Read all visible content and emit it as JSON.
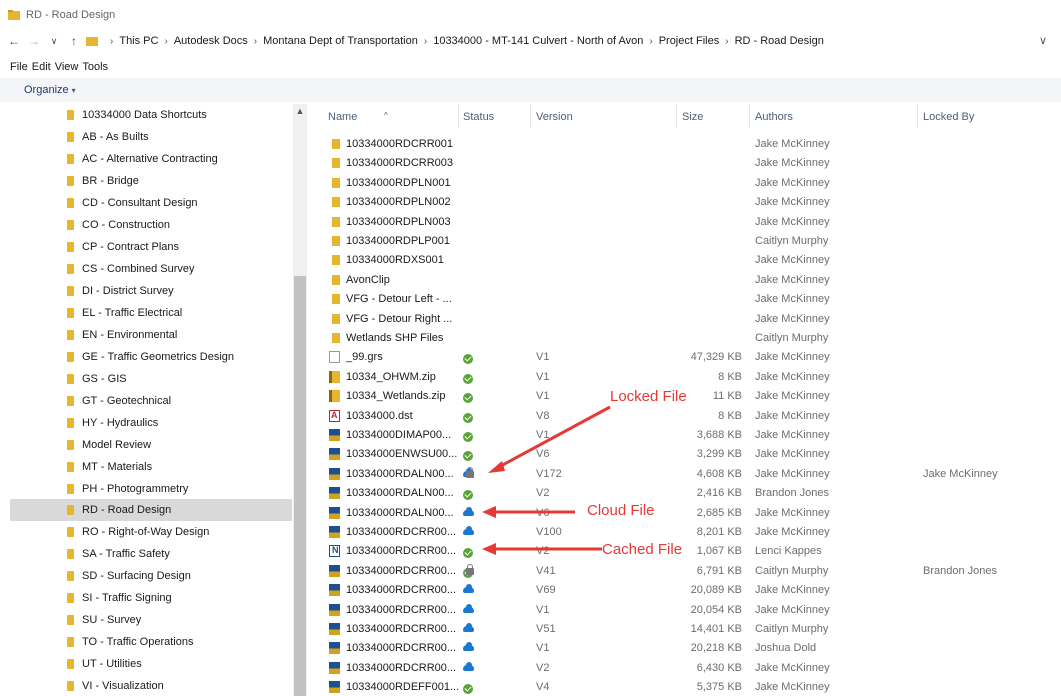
{
  "window": {
    "title": "RD - Road Design"
  },
  "address": {
    "back_glyph": "←",
    "forward_glyph": "→",
    "dropdown_glyph": "∨",
    "up_glyph": "↑",
    "separator": "›",
    "crumbs": [
      "This PC",
      "Autodesk Docs",
      "Montana Dept of Transportation",
      "10334000 - MT-141 Culvert - North of Avon",
      "Project Files",
      "RD - Road Design"
    ],
    "history_glyph": "∨"
  },
  "menu": {
    "items": [
      "File",
      "Edit",
      "View",
      "Tools"
    ]
  },
  "commandbar": {
    "organize": "Organize",
    "caret": "▾"
  },
  "nav": {
    "items": [
      "10334000 Data Shortcuts",
      "AB - As Builts",
      "AC - Alternative Contracting",
      "BR - Bridge",
      "CD - Consultant Design",
      "CO - Construction",
      "CP - Contract Plans",
      "CS - Combined Survey",
      "DI - District Survey",
      "EL - Traffic Electrical",
      "EN - Environmental",
      "GE - Traffic Geometrics Design",
      "GS - GIS",
      "GT - Geotechnical",
      "HY - Hydraulics",
      "Model Review",
      "MT - Materials",
      "PH - Photogrammetry",
      "RD - Road Design",
      "RO - Right-of-Way Design",
      "SA - Traffic Safety",
      "SD - Surfacing Design",
      "SI - Traffic Signing",
      "SU - Survey",
      "TO - Traffic Operations",
      "UT - Utilities",
      "VI - Visualization"
    ],
    "selected_index": 18,
    "scroll_up_glyph": "▲"
  },
  "columns": {
    "name": "Name",
    "status": "Status",
    "version": "Version",
    "size": "Size",
    "authors": "Authors",
    "locked_by": "Locked By",
    "sort_glyph": "^"
  },
  "files": [
    {
      "name": "10334000RDCRR001",
      "icon": "folder",
      "status": "",
      "version": "",
      "size": "",
      "author": "Jake McKinney",
      "locked_by": ""
    },
    {
      "name": "10334000RDCRR003",
      "icon": "folder",
      "status": "",
      "version": "",
      "size": "",
      "author": "Jake McKinney",
      "locked_by": ""
    },
    {
      "name": "10334000RDPLN001",
      "icon": "folder",
      "status": "",
      "version": "",
      "size": "",
      "author": "Jake McKinney",
      "locked_by": ""
    },
    {
      "name": "10334000RDPLN002",
      "icon": "folder",
      "status": "",
      "version": "",
      "size": "",
      "author": "Jake McKinney",
      "locked_by": ""
    },
    {
      "name": "10334000RDPLN003",
      "icon": "folder",
      "status": "",
      "version": "",
      "size": "",
      "author": "Jake McKinney",
      "locked_by": ""
    },
    {
      "name": "10334000RDPLP001",
      "icon": "folder",
      "status": "",
      "version": "",
      "size": "",
      "author": "Caitlyn Murphy",
      "locked_by": ""
    },
    {
      "name": "10334000RDXS001",
      "icon": "folder",
      "status": "",
      "version": "",
      "size": "",
      "author": "Jake McKinney",
      "locked_by": ""
    },
    {
      "name": "AvonClip",
      "icon": "folder",
      "status": "",
      "version": "",
      "size": "",
      "author": "Jake McKinney",
      "locked_by": ""
    },
    {
      "name": "VFG - Detour Left - ...",
      "icon": "folder",
      "status": "",
      "version": "",
      "size": "",
      "author": "Jake McKinney",
      "locked_by": ""
    },
    {
      "name": "VFG - Detour Right ...",
      "icon": "folder",
      "status": "",
      "version": "",
      "size": "",
      "author": "Jake McKinney",
      "locked_by": ""
    },
    {
      "name": "Wetlands SHP Files",
      "icon": "folder",
      "status": "",
      "version": "",
      "size": "",
      "author": "Caitlyn Murphy",
      "locked_by": ""
    },
    {
      "name": "_99.grs",
      "icon": "doc",
      "status": "cached",
      "version": "V1",
      "size": "47,329 KB",
      "author": "Jake McKinney",
      "locked_by": ""
    },
    {
      "name": "10334_OHWM.zip",
      "icon": "zip",
      "status": "cached",
      "version": "V1",
      "size": "8 KB",
      "author": "Jake McKinney",
      "locked_by": ""
    },
    {
      "name": "10334_Wetlands.zip",
      "icon": "zip",
      "status": "cached",
      "version": "V1",
      "size": "11 KB",
      "author": "Jake McKinney",
      "locked_by": ""
    },
    {
      "name": "10334000.dst",
      "icon": "dst",
      "status": "cached",
      "version": "V8",
      "size": "8 KB",
      "author": "Jake McKinney",
      "locked_by": ""
    },
    {
      "name": "10334000DIMAP00...",
      "icon": "dgn",
      "status": "cached",
      "version": "V1",
      "size": "3,688 KB",
      "author": "Jake McKinney",
      "locked_by": ""
    },
    {
      "name": "10334000ENWSU00...",
      "icon": "dgn",
      "status": "cached",
      "version": "V6",
      "size": "3,299 KB",
      "author": "Jake McKinney",
      "locked_by": ""
    },
    {
      "name": "10334000RDALN00...",
      "icon": "dgn",
      "status": "cloud-locked",
      "version": "V172",
      "size": "4,608 KB",
      "author": "Jake McKinney",
      "locked_by": "Jake McKinney"
    },
    {
      "name": "10334000RDALN00...",
      "icon": "dgn",
      "status": "cached",
      "version": "V2",
      "size": "2,416 KB",
      "author": "Brandon Jones",
      "locked_by": ""
    },
    {
      "name": "10334000RDALN00...",
      "icon": "dgn",
      "status": "cloud",
      "version": "V6",
      "size": "2,685 KB",
      "author": "Jake McKinney",
      "locked_by": ""
    },
    {
      "name": "10334000RDCRR00...",
      "icon": "dgn",
      "status": "cloud",
      "version": "V100",
      "size": "8,201 KB",
      "author": "Jake McKinney",
      "locked_by": ""
    },
    {
      "name": "10334000RDCRR00...",
      "icon": "dgnn",
      "status": "cached",
      "version": "V2",
      "size": "1,067 KB",
      "author": "Lenci Kappes",
      "locked_by": ""
    },
    {
      "name": "10334000RDCRR00...",
      "icon": "dgn",
      "status": "cached-locked",
      "version": "V41",
      "size": "6,791 KB",
      "author": "Caitlyn Murphy",
      "locked_by": "Brandon Jones"
    },
    {
      "name": "10334000RDCRR00...",
      "icon": "dgn",
      "status": "cloud",
      "version": "V69",
      "size": "20,089 KB",
      "author": "Jake McKinney",
      "locked_by": ""
    },
    {
      "name": "10334000RDCRR00...",
      "icon": "dgn",
      "status": "cloud",
      "version": "V1",
      "size": "20,054 KB",
      "author": "Jake McKinney",
      "locked_by": ""
    },
    {
      "name": "10334000RDCRR00...",
      "icon": "dgn",
      "status": "cloud",
      "version": "V51",
      "size": "14,401 KB",
      "author": "Caitlyn Murphy",
      "locked_by": ""
    },
    {
      "name": "10334000RDCRR00...",
      "icon": "dgn",
      "status": "cloud",
      "version": "V1",
      "size": "20,218 KB",
      "author": "Joshua Dold",
      "locked_by": ""
    },
    {
      "name": "10334000RDCRR00...",
      "icon": "dgn",
      "status": "cloud",
      "version": "V2",
      "size": "6,430 KB",
      "author": "Jake McKinney",
      "locked_by": ""
    },
    {
      "name": "10334000RDEFF001...",
      "icon": "dgn",
      "status": "cached",
      "version": "V4",
      "size": "5,375 KB",
      "author": "Jake McKinney",
      "locked_by": ""
    }
  ],
  "annotations": {
    "locked": "Locked File",
    "cloud": "Cloud File",
    "cached": "Cached File",
    "color": "#e53935"
  }
}
